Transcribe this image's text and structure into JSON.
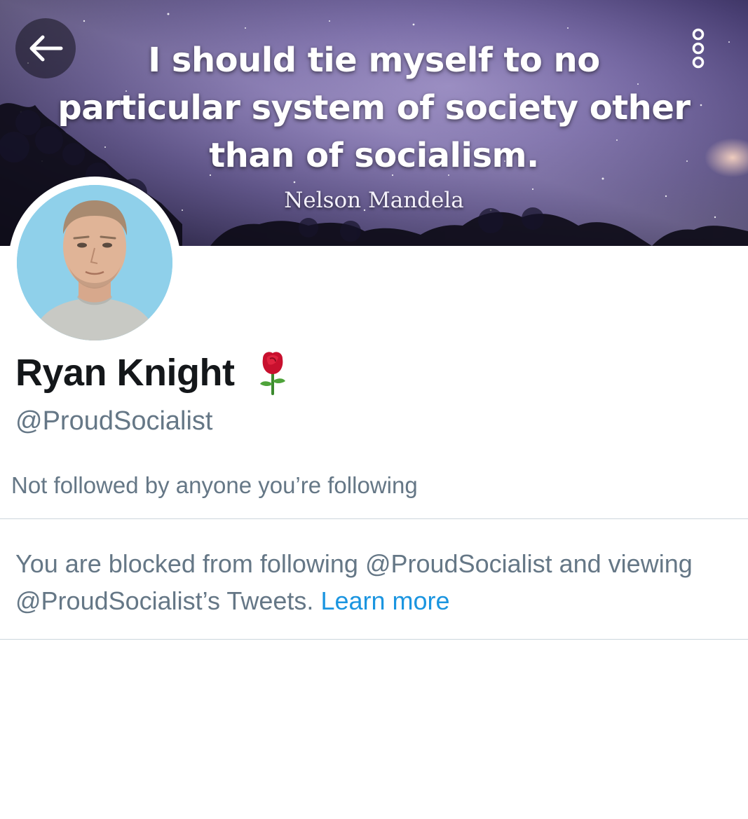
{
  "header": {
    "back_icon": "arrow-left-icon",
    "more_icon": "more-vertical-icon",
    "banner": {
      "quote_lines": [
        "I should tie myself to no",
        "particular system of society other",
        "than of socialism."
      ],
      "author": "Nelson Mandela"
    }
  },
  "profile": {
    "display_name": "Ryan Knight",
    "name_emoji_icon": "rose-icon",
    "handle": "@ProudSocialist",
    "followers_note": "Not followed by anyone you’re following"
  },
  "blocked_notice": {
    "text": "You are blocked from following @ProudSocialist and viewing @ProudSocialist’s Tweets.",
    "link_label": "Learn more"
  },
  "colors": {
    "text_primary": "#14171a",
    "text_secondary": "#657786",
    "link": "#1b95e0",
    "divider": "#ccd6dd"
  }
}
